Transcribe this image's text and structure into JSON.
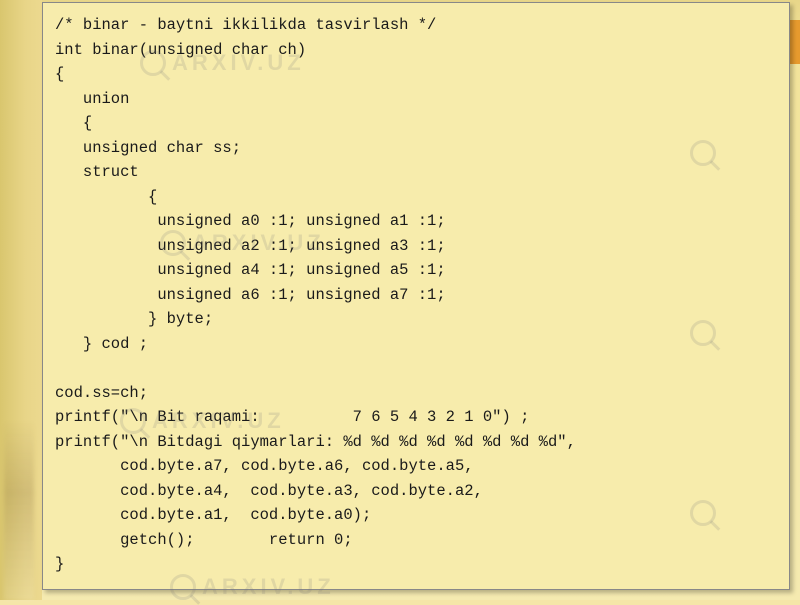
{
  "watermark_text": "ARXIV.UZ",
  "code_lines": [
    "/* binar - baytni ikkilikda tasvirlash */",
    "int binar(unsigned char ch)",
    "{",
    "   union",
    "   {",
    "   unsigned char ss;",
    "   struct",
    "          {",
    "           unsigned a0 :1; unsigned a1 :1;",
    "           unsigned a2 :1; unsigned a3 :1;",
    "           unsigned a4 :1; unsigned a5 :1;",
    "           unsigned a6 :1; unsigned a7 :1;",
    "          } byte;",
    "   } cod ;",
    "",
    "cod.ss=ch;",
    "printf(\"\\n Bit raqami:          7 6 5 4 3 2 1 0\") ;",
    "printf(\"\\n Bitdagi qiymarlari: %d %d %d %d %d %d %d %d\",",
    "       cod.byte.a7, cod.byte.a6, cod.byte.a5,",
    "       cod.byte.a4,  cod.byte.a3, cod.byte.a2,",
    "       cod.byte.a1,  cod.byte.a0);",
    "       getch();        return 0;",
    "}"
  ]
}
